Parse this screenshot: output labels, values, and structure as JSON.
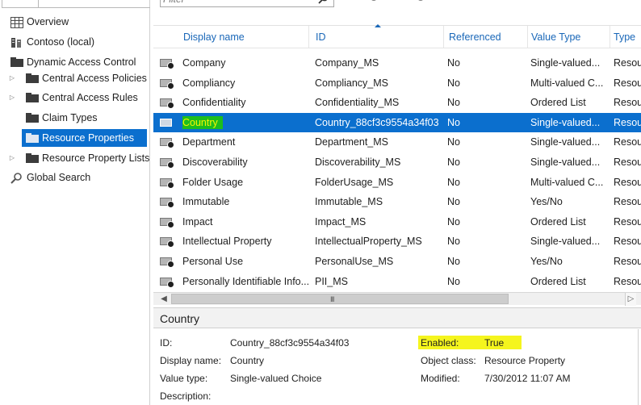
{
  "nav": {
    "items": [
      {
        "label": "Overview",
        "icon": "overview-icon"
      },
      {
        "label": "Contoso (local)",
        "icon": "domain-icon"
      },
      {
        "label": "Dynamic Access Control",
        "icon": "folder-icon"
      },
      {
        "label": "Central Access Policies",
        "icon": "folder-icon"
      },
      {
        "label": "Central Access Rules",
        "icon": "folder-icon"
      },
      {
        "label": "Claim Types",
        "icon": "folder-icon"
      },
      {
        "label": "Resource Properties",
        "icon": "folder-icon",
        "selected": true
      },
      {
        "label": "Resource Property Lists",
        "icon": "folder-icon"
      },
      {
        "label": "Global Search",
        "icon": "search-icon"
      }
    ]
  },
  "toolbar": {
    "filter_placeholder": "Filter"
  },
  "grid": {
    "columns": [
      "Display name",
      "ID",
      "Referenced",
      "Value Type",
      "Type"
    ],
    "sort_column": "ID",
    "rows": [
      {
        "name": "Company",
        "id": "Company_MS",
        "referenced": "No",
        "value_type": "Single-valued...",
        "type": "Resou"
      },
      {
        "name": "Compliancy",
        "id": "Compliancy_MS",
        "referenced": "No",
        "value_type": "Multi-valued C...",
        "type": "Resou"
      },
      {
        "name": "Confidentiality",
        "id": "Confidentiality_MS",
        "referenced": "No",
        "value_type": "Ordered List",
        "type": "Resou"
      },
      {
        "name": "Country",
        "id": "Country_88cf3c9554a34f03",
        "referenced": "No",
        "value_type": "Single-valued...",
        "type": "Resou",
        "selected": true
      },
      {
        "name": "Department",
        "id": "Department_MS",
        "referenced": "No",
        "value_type": "Single-valued...",
        "type": "Resou"
      },
      {
        "name": "Discoverability",
        "id": "Discoverability_MS",
        "referenced": "No",
        "value_type": "Single-valued...",
        "type": "Resou"
      },
      {
        "name": "Folder Usage",
        "id": "FolderUsage_MS",
        "referenced": "No",
        "value_type": "Multi-valued C...",
        "type": "Resou"
      },
      {
        "name": "Immutable",
        "id": "Immutable_MS",
        "referenced": "No",
        "value_type": "Yes/No",
        "type": "Resou"
      },
      {
        "name": "Impact",
        "id": "Impact_MS",
        "referenced": "No",
        "value_type": "Ordered List",
        "type": "Resou"
      },
      {
        "name": "Intellectual Property",
        "id": "IntellectualProperty_MS",
        "referenced": "No",
        "value_type": "Single-valued...",
        "type": "Resou"
      },
      {
        "name": "Personal Use",
        "id": "PersonalUse_MS",
        "referenced": "No",
        "value_type": "Yes/No",
        "type": "Resou"
      },
      {
        "name": "Personally Identifiable Info...",
        "id": "PII_MS",
        "referenced": "No",
        "value_type": "Ordered List",
        "type": "Resou"
      }
    ]
  },
  "details": {
    "title": "Country",
    "id_label": "ID:",
    "id_value": "Country_88cf3c9554a34f03",
    "display_name_label": "Display name:",
    "display_name_value": "Country",
    "value_type_label": "Value type:",
    "value_type_value": "Single-valued Choice",
    "description_label": "Description:",
    "enabled_label": "Enabled:",
    "enabled_value": "True",
    "object_class_label": "Object class:",
    "object_class_value": "Resource Property",
    "modified_label": "Modified:",
    "modified_value": "7/30/2012 11:07 AM"
  },
  "colors": {
    "selection": "#0b6fce",
    "header_text": "#1967b8",
    "name_highlight_bg": "#1dbd1d",
    "name_highlight_text": "#f6f600",
    "enabled_highlight": "#f5f51e"
  }
}
